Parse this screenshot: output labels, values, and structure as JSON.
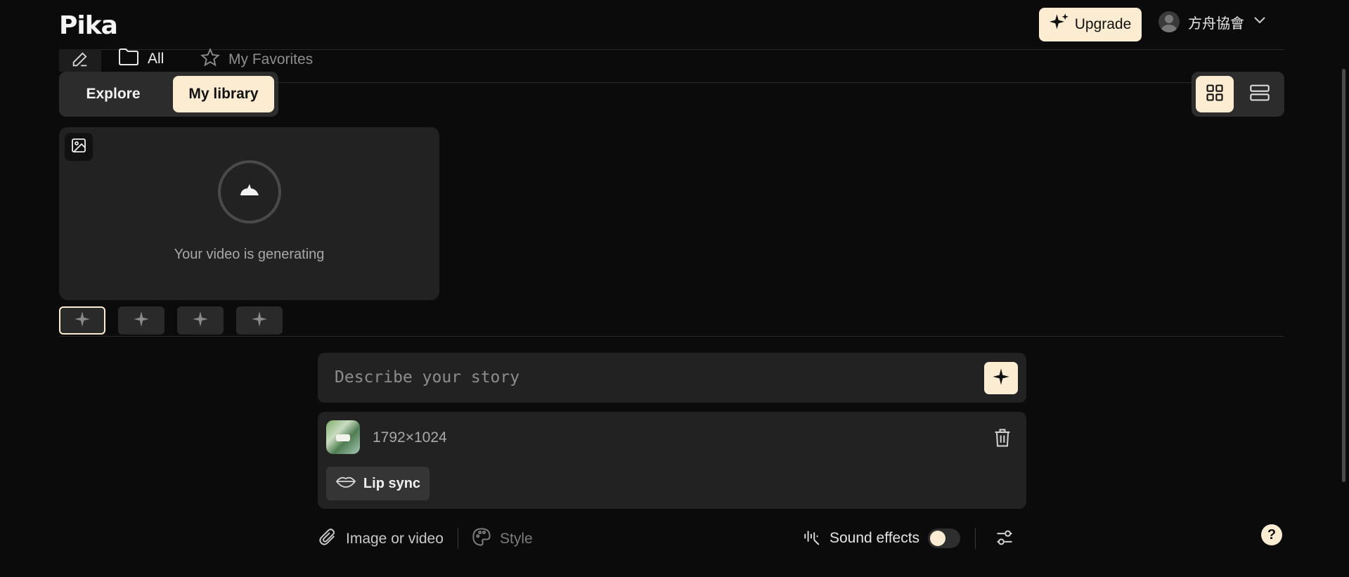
{
  "header": {
    "logo": "Pika",
    "upgrade_label": "Upgrade",
    "username": "方舟協會"
  },
  "filters": {
    "all_label": "All",
    "favorites_label": "My Favorites"
  },
  "nav_tabs": {
    "explore_label": "Explore",
    "library_label": "My library",
    "selected": "My library"
  },
  "view_toggle": {
    "selected": "grid"
  },
  "generation_card": {
    "status_text": "Your video is generating"
  },
  "thumbnails": [
    {
      "selected": true
    },
    {
      "selected": false
    },
    {
      "selected": false
    },
    {
      "selected": false
    }
  ],
  "prompt": {
    "placeholder": "Describe your story"
  },
  "attachment": {
    "dimensions": "1792×1024",
    "lip_sync_label": "Lip sync"
  },
  "toolbar": {
    "image_or_video_label": "Image or video",
    "style_label": "Style",
    "sound_effects_label": "Sound effects",
    "sound_effects_on": false
  },
  "help": {
    "label": "?"
  },
  "colors": {
    "background": "#0b0b0b",
    "accent": "#fcecd2",
    "panel": "#222222"
  }
}
